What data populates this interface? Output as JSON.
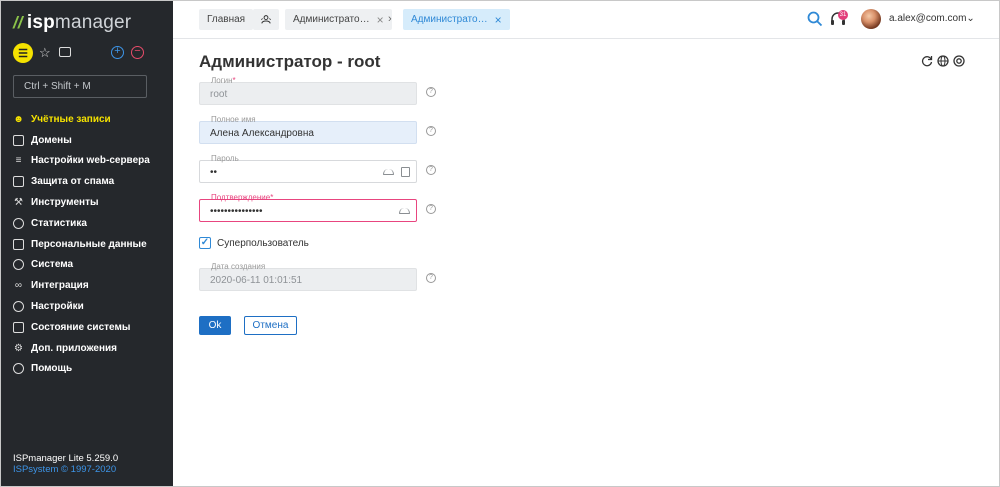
{
  "sidebar": {
    "logo_mark": "//",
    "logo_isp": "isp",
    "logo_manager": "manager",
    "search_placeholder": "Ctrl + Shift + M",
    "items": [
      {
        "label": "Учётные записи",
        "icon": "users-icon",
        "active": true
      },
      {
        "label": "Домены",
        "icon": "domains-icon"
      },
      {
        "label": "Настройки web-сервера",
        "icon": "webserver-settings-icon"
      },
      {
        "label": "Защита от спама",
        "icon": "spam-protection-icon"
      },
      {
        "label": "Инструменты",
        "icon": "tools-icon"
      },
      {
        "label": "Статистика",
        "icon": "statistics-icon"
      },
      {
        "label": "Персональные данные",
        "icon": "personal-data-icon"
      },
      {
        "label": "Система",
        "icon": "system-icon"
      },
      {
        "label": "Интеграция",
        "icon": "integration-icon"
      },
      {
        "label": "Настройки",
        "icon": "settings-icon"
      },
      {
        "label": "Состояние системы",
        "icon": "monitor-icon"
      },
      {
        "label": "Доп. приложения",
        "icon": "apps-icon"
      },
      {
        "label": "Помощь",
        "icon": "help-icon"
      }
    ],
    "version": "ISPmanager Lite 5.259.0",
    "copyright": "ISPsystem © 1997-2020"
  },
  "topbar": {
    "breadcrumbs": [
      {
        "label": "Главная"
      },
      {
        "label": "Администрато…"
      },
      {
        "label": "Администрато…"
      }
    ],
    "notification_count": "31",
    "user": "a.alex@com.com"
  },
  "form": {
    "title": "Администратор - root",
    "login_label": "Логин",
    "login_value": "root",
    "fullname_label": "Полное имя",
    "fullname_value": "Алена Александровна",
    "password_label": "Пароль",
    "password_value": "••",
    "confirm_label": "Подтверждение",
    "confirm_value": "•••••••••••••••",
    "required_mark": "*",
    "superuser_label": "Суперпользователь",
    "superuser_checked": true,
    "created_label": "Дата создания",
    "created_value": "2020-06-11 01:01:51",
    "ok_label": "Ok",
    "cancel_label": "Отмена",
    "help_glyph": "?"
  },
  "colors": {
    "sidebar_bg": "#25282c",
    "accent_yellow": "#f5e200",
    "primary_blue": "#1e6fc4",
    "error_pink": "#e8457f"
  }
}
